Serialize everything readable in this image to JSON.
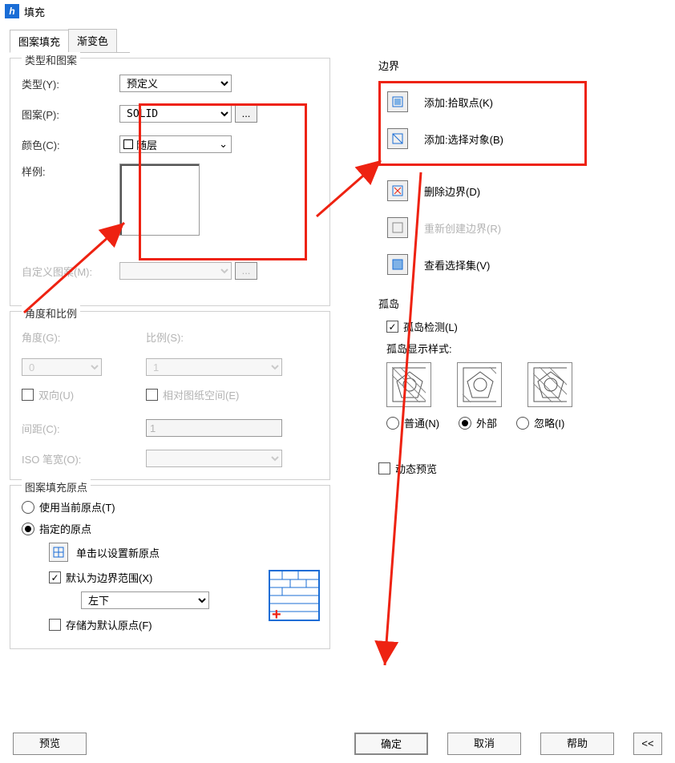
{
  "window": {
    "title": "填充"
  },
  "tabs": {
    "hatch": "图案填充",
    "gradient": "渐变色"
  },
  "type_pattern": {
    "group_title": "类型和图案",
    "type_label": "类型(Y):",
    "type_value": "预定义",
    "pattern_label": "图案(P):",
    "pattern_value": "SOLID",
    "pattern_more": "...",
    "color_label": "颜色(C):",
    "color_value": "随层",
    "sample_label": "样例:",
    "custom_label": "自定义图案(M):",
    "custom_more": "..."
  },
  "angle_scale": {
    "group_title": "角度和比例",
    "angle_label": "角度(G):",
    "angle_value": "0",
    "scale_label": "比例(S):",
    "scale_value": "1",
    "double_label": "双向(U)",
    "relative_label": "相对图纸空间(E)",
    "spacing_label": "间距(C):",
    "spacing_value": "1",
    "iso_label": "ISO 笔宽(O):"
  },
  "origin": {
    "group_title": "图案填充原点",
    "use_current": "使用当前原点(T)",
    "specified": "指定的原点",
    "click_set": "单击以设置新原点",
    "default_extents": "默认为边界范围(X)",
    "position_value": "左下",
    "store_default": "存储为默认原点(F)"
  },
  "boundary": {
    "group_title": "边界",
    "pick_points": "添加:拾取点(K)",
    "select_objects": "添加:选择对象(B)",
    "remove": "删除边界(D)",
    "recreate": "重新创建边界(R)",
    "view_selection": "查看选择集(V)"
  },
  "islands": {
    "group_title": "孤岛",
    "detect": "孤岛检测(L)",
    "style_label": "孤岛显示样式:",
    "normal": "普通(N)",
    "outer": "外部",
    "ignore": "忽略(I)"
  },
  "dynamic_preview": "动态预览",
  "footer": {
    "preview": "预览",
    "ok": "确定",
    "cancel": "取消",
    "help": "帮助",
    "expand": "<<"
  }
}
